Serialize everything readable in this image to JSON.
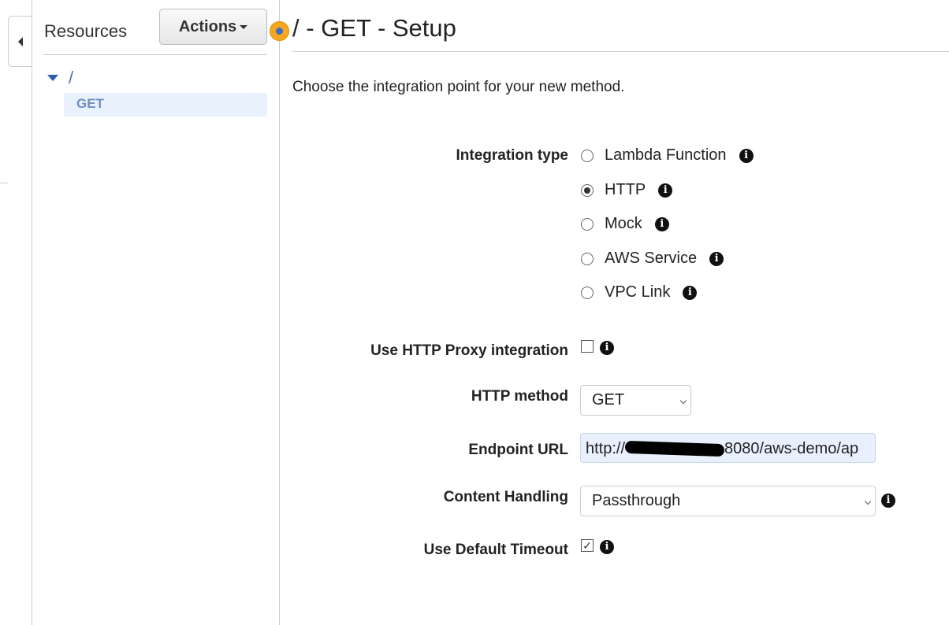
{
  "sidebar": {
    "title": "Resources",
    "actions_label": "Actions",
    "tree": {
      "root": "/",
      "child": "GET"
    }
  },
  "main": {
    "title": "/ - GET - Setup",
    "intro": "Choose the integration point for your new method.",
    "integration_type": {
      "label": "Integration type",
      "options": [
        "Lambda Function",
        "HTTP",
        "Mock",
        "AWS Service",
        "VPC Link"
      ],
      "selected": "HTTP"
    },
    "proxy": {
      "label": "Use HTTP Proxy integration",
      "checked": false
    },
    "http_method": {
      "label": "HTTP method",
      "value": "GET"
    },
    "endpoint": {
      "label": "Endpoint URL",
      "prefix": "http://",
      "suffix": "8080/aws-demo/ap"
    },
    "content_handling": {
      "label": "Content Handling",
      "value": "Passthrough"
    },
    "timeout": {
      "label": "Use Default Timeout",
      "checked": true
    }
  },
  "colors": {
    "accent": "#f5a623",
    "link": "#4a70b8",
    "selected_bg": "#e8f1fc"
  }
}
